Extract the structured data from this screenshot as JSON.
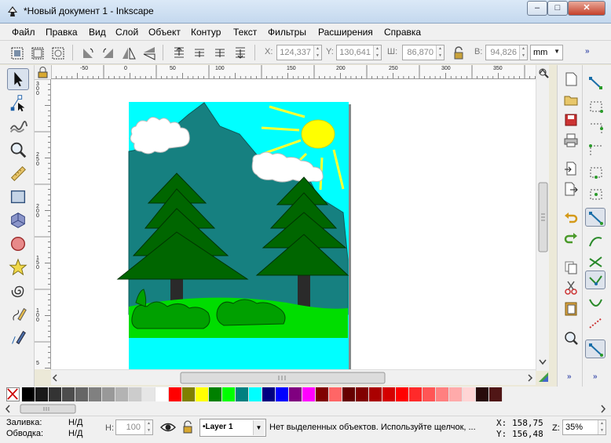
{
  "window": {
    "title": "*Новый документ 1 - Inkscape",
    "minimize_glyph": "–",
    "maximize_glyph": "□",
    "close_glyph": "✕"
  },
  "menu": [
    "Файл",
    "Правка",
    "Вид",
    "Слой",
    "Объект",
    "Контур",
    "Текст",
    "Фильтры",
    "Расширения",
    "Справка"
  ],
  "toolbar": {
    "x_label": "X:",
    "x_value": "124,337",
    "y_label": "Y:",
    "y_value": "130,641",
    "w_label": "Ш:",
    "w_value": "86,870",
    "h_label": "В:",
    "h_value": "94,826",
    "unit": "mm",
    "overflow": "»"
  },
  "rulers": {
    "top": [
      "-50",
      "0",
      "50",
      "100",
      "150",
      "200",
      "250",
      "300",
      "350"
    ],
    "left": [
      "3\n0\n0",
      "2\n5\n0",
      "2\n0\n0",
      "1\n5\n0",
      "1\n0\n0",
      "5"
    ]
  },
  "palette": {
    "colors": [
      "#000000",
      "#1a1a1a",
      "#333333",
      "#4d4d4d",
      "#666666",
      "#808080",
      "#999999",
      "#b3b3b3",
      "#cccccc",
      "#e6e6e6",
      "#ffffff",
      "#ff0000",
      "#808000",
      "#ffff00",
      "#008000",
      "#00ff00",
      "#008080",
      "#00ffff",
      "#000080",
      "#0000ff",
      "#800080",
      "#ff00ff",
      "#800000",
      "#ff6666",
      "#660000",
      "#800000",
      "#aa0000",
      "#d40000",
      "#ff0000",
      "#ff2a2a",
      "#ff5555",
      "#ff8080",
      "#ffaaaa",
      "#ffd5d5",
      "#280b0b",
      "#501616"
    ]
  },
  "status": {
    "fill_label": "Заливка:",
    "fill_value": "Н/Д",
    "stroke_label": "Обводка:",
    "stroke_value": "Н/Д",
    "h_label": "H:",
    "h_value": "100",
    "layer": "•Layer 1",
    "message": "Нет выделенных объектов. Используйте щелчок, ...",
    "x_label": "X:",
    "x_value": "158,75",
    "y_label": "Y:",
    "y_value": "156,48",
    "zoom_label": "Z:",
    "zoom_value": "35%"
  }
}
